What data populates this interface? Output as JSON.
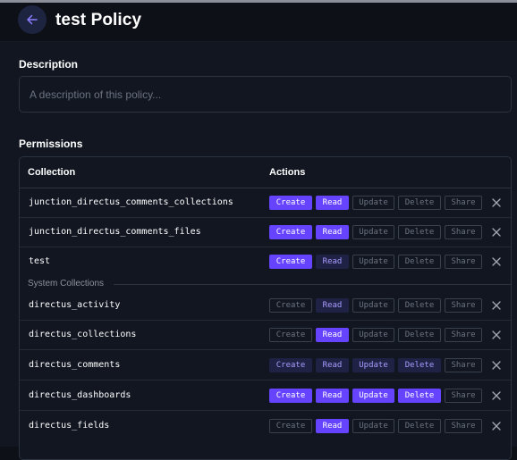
{
  "header": {
    "title": "test Policy",
    "back_icon": "arrow-left-icon"
  },
  "description": {
    "label": "Description",
    "placeholder": "A description of this policy...",
    "value": ""
  },
  "permissions": {
    "label": "Permissions",
    "columns": {
      "collection": "Collection",
      "actions": "Actions"
    },
    "action_labels": [
      "Create",
      "Read",
      "Update",
      "Delete",
      "Share"
    ],
    "system_collections_label": "System Collections",
    "colors": {
      "full": "#6644ff",
      "partial": "#1f2245",
      "none": "#3a414e"
    },
    "rows": [
      {
        "collection": "junction_directus_comments_collections",
        "states": [
          "full",
          "full",
          "none",
          "none",
          "none"
        ]
      },
      {
        "collection": "junction_directus_comments_files",
        "states": [
          "full",
          "full",
          "none",
          "none",
          "none"
        ]
      },
      {
        "collection": "test",
        "states": [
          "full",
          "partial",
          "none",
          "none",
          "none"
        ]
      },
      {
        "collection": "directus_activity",
        "states": [
          "none",
          "partial",
          "none",
          "none",
          "none"
        ]
      },
      {
        "collection": "directus_collections",
        "states": [
          "none",
          "full",
          "none",
          "none",
          "none"
        ]
      },
      {
        "collection": "directus_comments",
        "states": [
          "partial",
          "partial",
          "partial",
          "partial",
          "none"
        ]
      },
      {
        "collection": "directus_dashboards",
        "states": [
          "full",
          "full",
          "full",
          "full",
          "none"
        ]
      },
      {
        "collection": "directus_fields",
        "states": [
          "none",
          "full",
          "none",
          "none",
          "none"
        ]
      }
    ]
  }
}
